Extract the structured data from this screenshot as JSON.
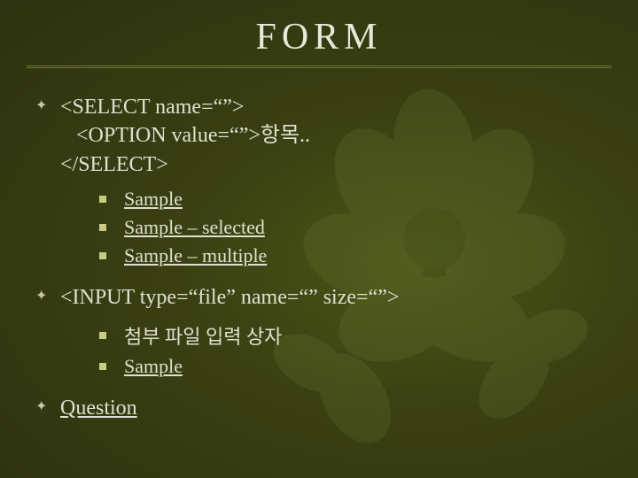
{
  "title": "FORM",
  "items": [
    {
      "lines": [
        "<SELECT name=“”>",
        "   <OPTION value=“”>항목..",
        "</SELECT>"
      ],
      "subs": [
        {
          "text": "Sample",
          "link": true
        },
        {
          "text": "Sample – selected",
          "link": true
        },
        {
          "text": "Sample – multiple",
          "link": true
        }
      ]
    },
    {
      "lines": [
        "<INPUT type=“file” name=“” size=“”>"
      ],
      "subs": [
        {
          "text": "첨부 파일 입력 상자",
          "link": false
        },
        {
          "text": "Sample",
          "link": true
        }
      ]
    }
  ],
  "footer_link": "Question"
}
